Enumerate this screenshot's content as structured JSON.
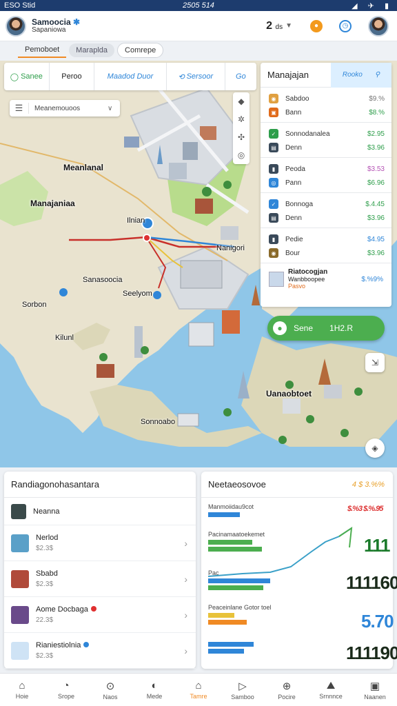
{
  "status_bar": {
    "left": "ESO Stid",
    "center": "2505 514",
    "right": "◢ ✈ ▮"
  },
  "app_bar": {
    "title": "Samoocia",
    "subtitle": "Sapaniowa",
    "count": "2",
    "count_unit": "ds"
  },
  "segments": [
    "Pemoboet",
    "Maraplda",
    "Comrepe"
  ],
  "filters": [
    "Sanee",
    "Peroo",
    "Maadod Duor",
    "Sersoor",
    "Go"
  ],
  "dropdown": {
    "value": "Meanemouoos"
  },
  "right_panel": {
    "title": "Manajajan",
    "tab": "Rooko",
    "groups": [
      {
        "rows": [
          {
            "label": "Sabdoo",
            "value": "$9.%",
            "color": "#777777",
            "icon": "#e0a040"
          },
          {
            "label": "Bann",
            "value": "$8.%",
            "color": "#2e9e4b",
            "icon": "#e06a1a"
          }
        ]
      },
      {
        "rows": [
          {
            "label": "Sonnodanalea",
            "value": "$2.95",
            "color": "#2e9e4b",
            "icon": "#2e9e4b"
          },
          {
            "label": "Denn",
            "value": "$3.96",
            "color": "#2e9e4b",
            "icon": "#3a4a5a"
          }
        ]
      },
      {
        "rows": [
          {
            "label": "Peoda",
            "value": "$3.53",
            "color": "#b452b4",
            "icon": "#3a4a5a"
          },
          {
            "label": "Pann",
            "value": "$6.96",
            "color": "#2e9e4b",
            "icon": "#2f86d8"
          }
        ]
      },
      {
        "rows": [
          {
            "label": "Bonnoga",
            "value": "$.4.45",
            "color": "#2e9e4b",
            "icon": "#2f86d8"
          },
          {
            "label": "Denn",
            "value": "$3.96",
            "color": "#2e9e4b",
            "icon": "#3a4a5a"
          }
        ]
      },
      {
        "rows": [
          {
            "label": "Pedie",
            "value": "$4.95",
            "color": "#2f86d8",
            "icon": "#3a4a5a"
          },
          {
            "label": "Bour",
            "value": "$3.96",
            "color": "#2e9e4b",
            "icon": "#8a6a2a"
          }
        ]
      }
    ],
    "footer": {
      "title": "Riatocogjan",
      "subtitle": "Wanbboopee",
      "note": "Pasvo",
      "value": "$.%9%"
    }
  },
  "cta": {
    "label": "Sene",
    "value": "1H2.R"
  },
  "map_labels": [
    "Manajaniaa",
    "Meanlanal",
    "Ilnian",
    "Nanigori",
    "Sanasoocia",
    "Seelyom",
    "Sorbon",
    "Kilunl",
    "Uanaobtoet",
    "Sonnoabo"
  ],
  "list_card": {
    "title": "Randiagonohasantara",
    "header_item": "Neanna",
    "items": [
      {
        "name": "Nerlod",
        "price": "$2.3$",
        "dot": ""
      },
      {
        "name": "Sbabd",
        "price": "$2.3$",
        "dot": ""
      },
      {
        "name": "Aome Docbaga",
        "price": "22.3$",
        "dot": "#e03030"
      },
      {
        "name": "Rianiestiolnia",
        "price": "$2.3$",
        "dot": "#2f86d8"
      }
    ]
  },
  "stats_card": {
    "title": "Neetaeosovoe",
    "amount": "4 $ 3.%%",
    "blocks": [
      {
        "label": "Manmoiidau9cot",
        "value": "$.%3 $.%.95"
      },
      {
        "label": "Pacinamaatoekemet",
        "value": "111"
      },
      {
        "label": "Pac",
        "value": "111160"
      },
      {
        "label": "Peaceinlane Gotor toel",
        "value": "5.70"
      },
      {
        "label": "",
        "value": "111190"
      }
    ]
  },
  "bottom_nav": [
    "Hoie",
    "Srope",
    "Naos",
    "Mede",
    "Tamre",
    "Samboo",
    "Pocire",
    "Srnnnce",
    "Naanen"
  ],
  "colors": {
    "accent": "#f08a24",
    "green": "#4cae4f",
    "blue": "#2f86d8",
    "header": "#1d3c6e"
  }
}
